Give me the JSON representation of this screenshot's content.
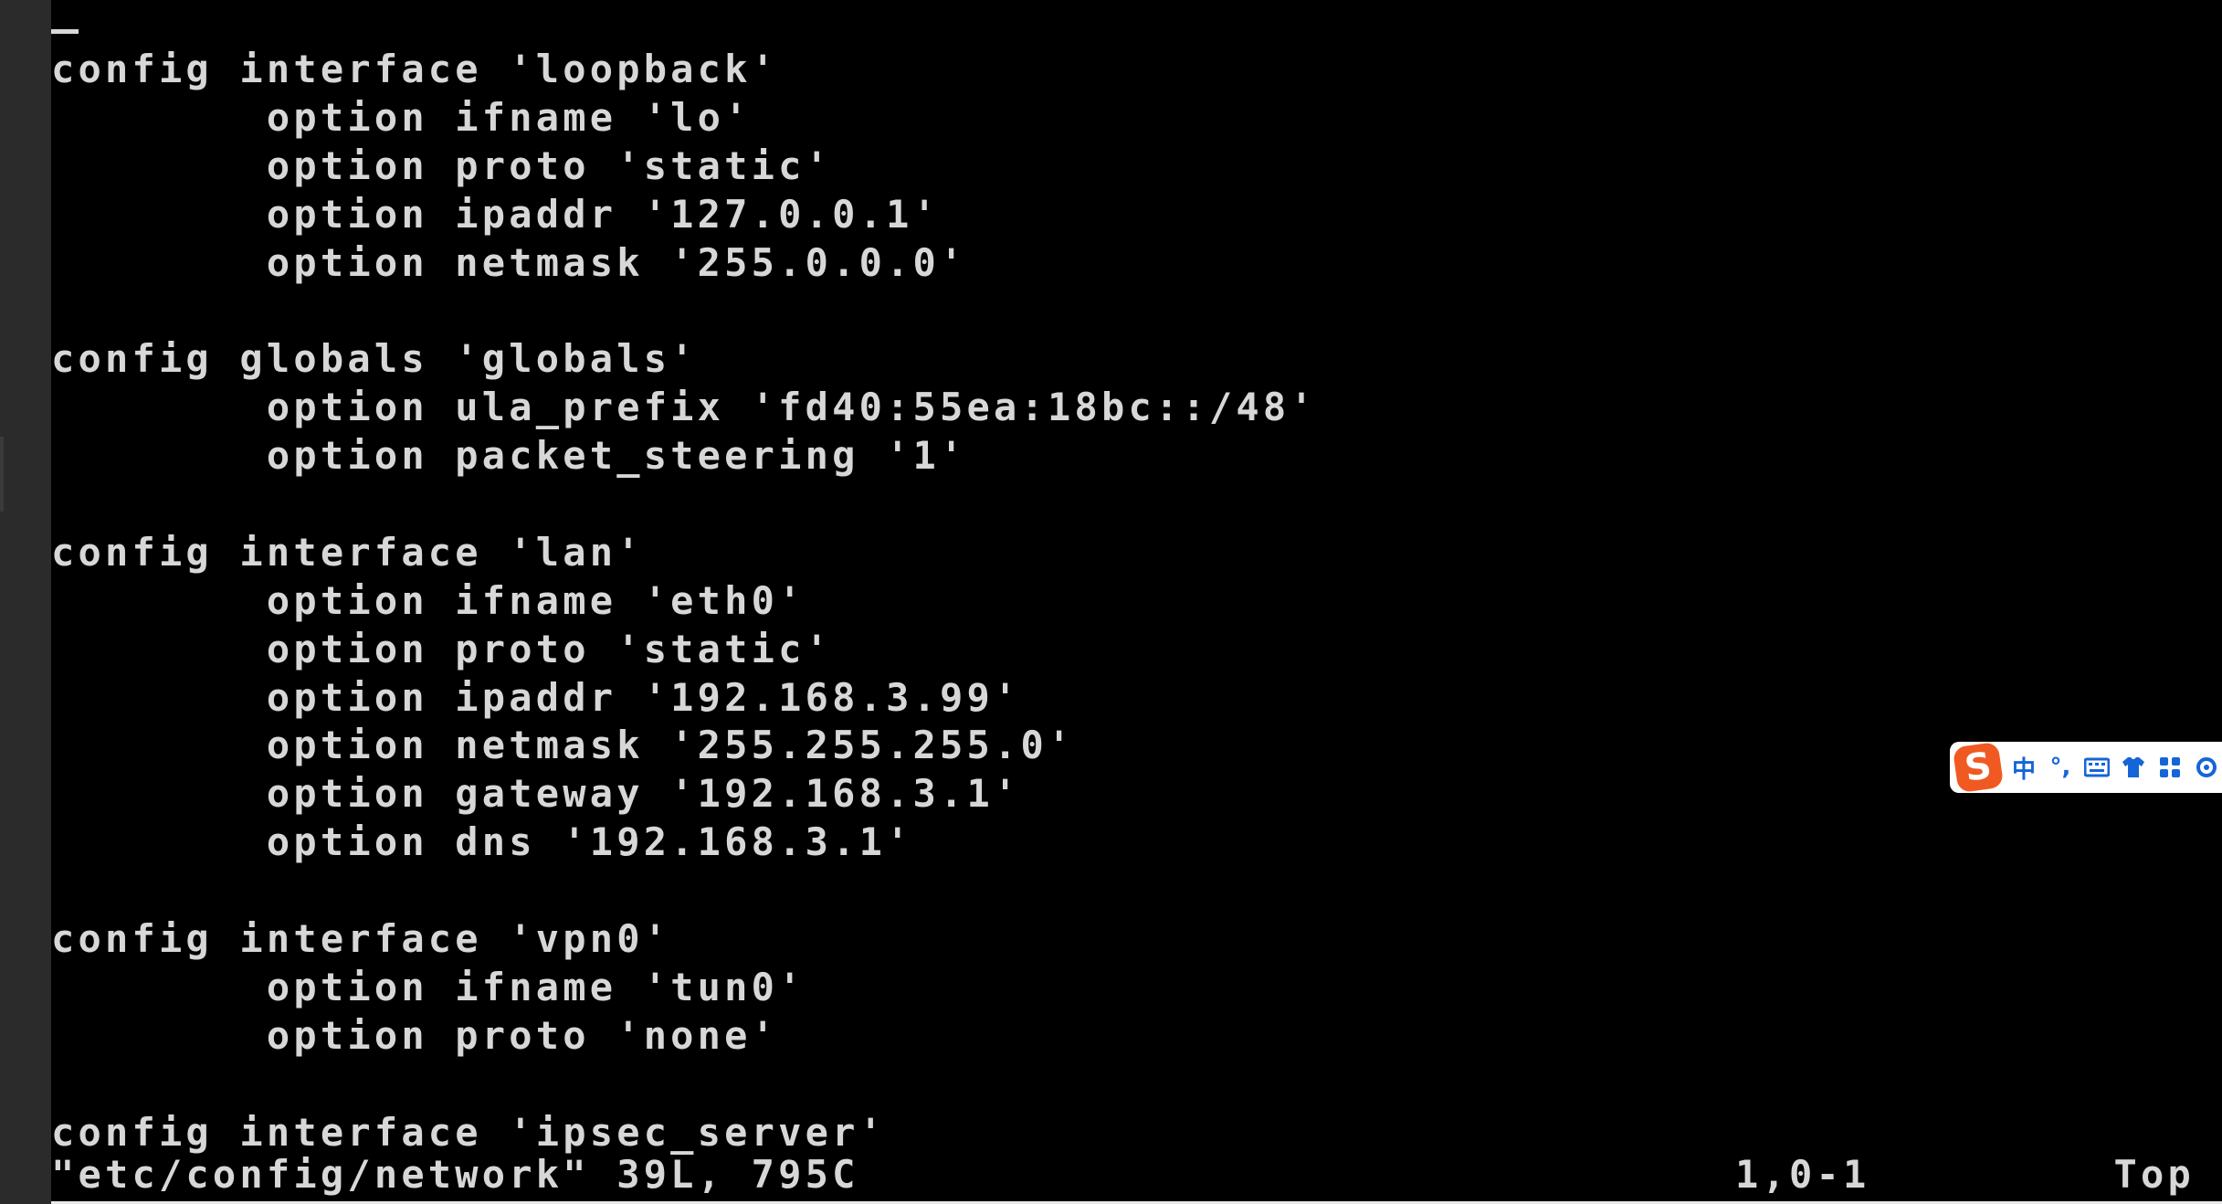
{
  "terminal": {
    "lines": [
      "config interface 'loopback'",
      "        option ifname 'lo'",
      "        option proto 'static'",
      "        option ipaddr '127.0.0.1'",
      "        option netmask '255.0.0.0'",
      "",
      "config globals 'globals'",
      "        option ula_prefix 'fd40:55ea:18bc::/48'",
      "        option packet_steering '1'",
      "",
      "config interface 'lan'",
      "        option ifname 'eth0'",
      "        option proto 'static'",
      "        option ipaddr '192.168.3.99'",
      "        option netmask '255.255.255.0'",
      "        option gateway '192.168.3.1'",
      "        option dns '192.168.3.1'",
      "",
      "config interface 'vpn0'",
      "        option ifname 'tun0'",
      "        option proto 'none'",
      "",
      "config interface 'ipsec_server'"
    ],
    "status": {
      "file": "\"etc/config/network\" 39L, 795C",
      "position": "1,0-1",
      "scroll": "Top"
    }
  },
  "ime_toolbar": {
    "logo": "S",
    "mode": "中",
    "punct": "°,",
    "icons": [
      "keyboard-icon",
      "skin-icon",
      "toolbox-icon",
      "settings-icon"
    ]
  },
  "colors": {
    "terminal_bg": "#000000",
    "terminal_fg": "#d7d7d7",
    "ime_accent": "#1565d8",
    "ime_logo": "#f05a22"
  }
}
